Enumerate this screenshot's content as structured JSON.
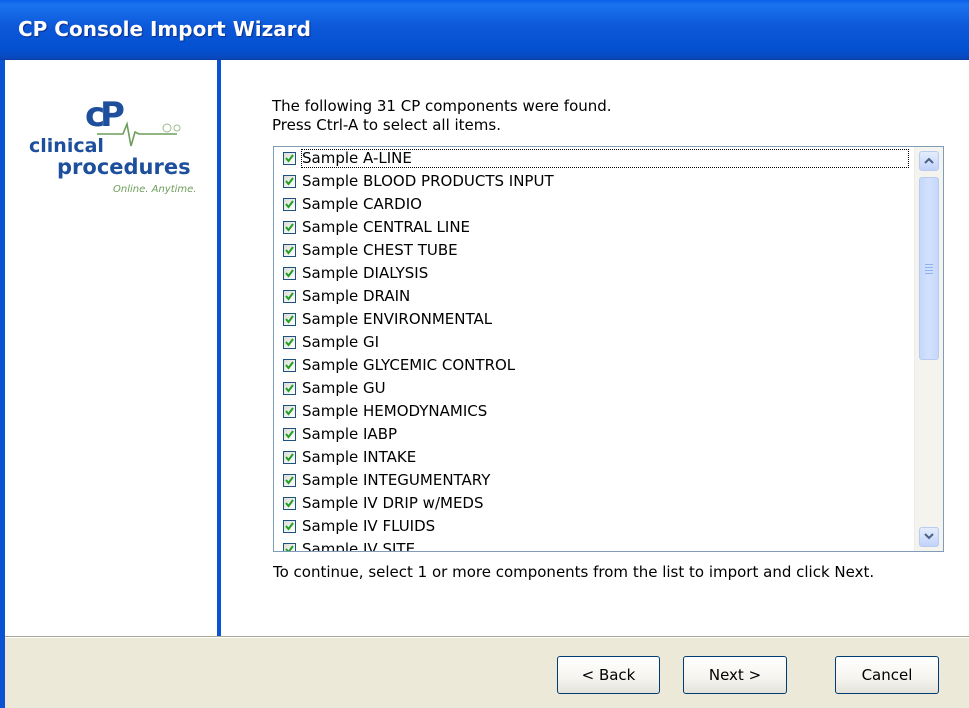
{
  "window": {
    "title": "CP Console Import Wizard"
  },
  "logo": {
    "line1": "clinical",
    "line2": "procedures",
    "tagline": "Online. Anytime."
  },
  "intro": {
    "line1": "The following 31 CP components were found.",
    "line2": "Press Ctrl-A to select all items."
  },
  "components": [
    {
      "label": "Sample A-LINE",
      "checked": true
    },
    {
      "label": "Sample BLOOD PRODUCTS INPUT",
      "checked": true
    },
    {
      "label": "Sample CARDIO",
      "checked": true
    },
    {
      "label": "Sample CENTRAL LINE",
      "checked": true
    },
    {
      "label": "Sample CHEST TUBE",
      "checked": true
    },
    {
      "label": "Sample DIALYSIS",
      "checked": true
    },
    {
      "label": "Sample DRAIN",
      "checked": true
    },
    {
      "label": "Sample ENVIRONMENTAL",
      "checked": true
    },
    {
      "label": "Sample GI",
      "checked": true
    },
    {
      "label": "Sample GLYCEMIC CONTROL",
      "checked": true
    },
    {
      "label": "Sample GU",
      "checked": true
    },
    {
      "label": "Sample HEMODYNAMICS",
      "checked": true
    },
    {
      "label": "Sample IABP",
      "checked": true
    },
    {
      "label": "Sample INTAKE",
      "checked": true
    },
    {
      "label": "Sample INTEGUMENTARY",
      "checked": true
    },
    {
      "label": "Sample IV DRIP w/MEDS",
      "checked": true
    },
    {
      "label": "Sample IV FLUIDS",
      "checked": true
    },
    {
      "label": "Sample IV SITE",
      "checked": true
    }
  ],
  "instructions": "To continue, select 1 or more components from the list to import and click Next.",
  "buttons": {
    "back": "< Back",
    "next": "Next >",
    "cancel": "Cancel"
  },
  "colors": {
    "title_bar": "#0350d0",
    "accent_blue": "#0a54d4",
    "logo_blue": "#1d4f9c",
    "logo_green": "#6d9d5a",
    "check_green": "#21a121"
  }
}
